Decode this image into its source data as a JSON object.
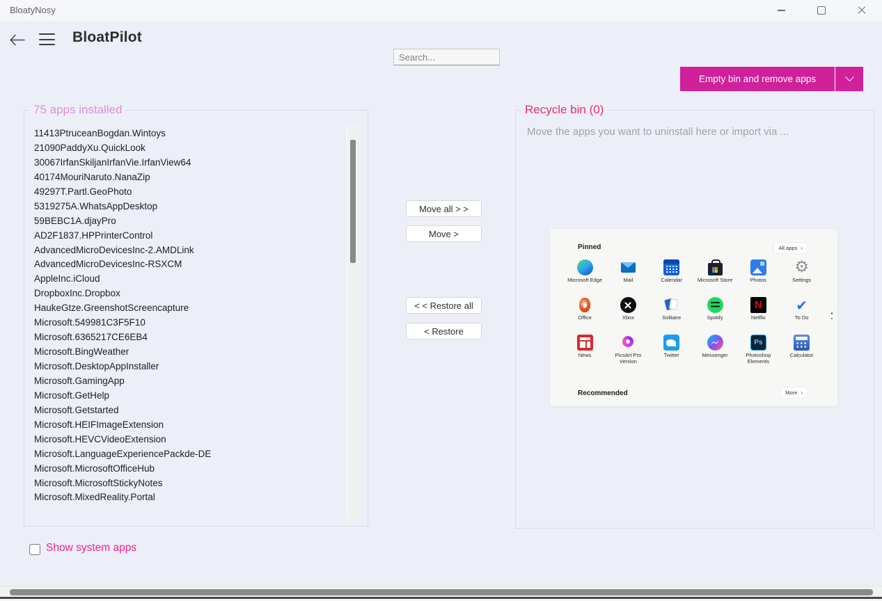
{
  "window": {
    "title": "BloatyNosy"
  },
  "header": {
    "title": "BloatPilot"
  },
  "search": {
    "placeholder": "Search..."
  },
  "primary_action": {
    "label": "Empty bin and remove apps"
  },
  "installed_panel": {
    "legend": "75 apps installed",
    "apps": [
      "11413PtruceanBogdan.Wintoys",
      "21090PaddyXu.QuickLook",
      "30067IrfanSkiljanIrfanVie.IrfanView64",
      "40174MouriNaruto.NanaZip",
      "49297T.Partl.GeoPhoto",
      "5319275A.WhatsAppDesktop",
      "59BEBC1A.djayPro",
      "AD2F1837.HPPrinterControl",
      "AdvancedMicroDevicesInc-2.AMDLink",
      "AdvancedMicroDevicesInc-RSXCM",
      "AppleInc.iCloud",
      "DropboxInc.Dropbox",
      "HaukeGtze.GreenshotScreencapture",
      "Microsoft.549981C3F5F10",
      "Microsoft.6365217CE6EB4",
      "Microsoft.BingWeather",
      "Microsoft.DesktopAppInstaller",
      "Microsoft.GamingApp",
      "Microsoft.GetHelp",
      "Microsoft.Getstarted",
      "Microsoft.HEIFImageExtension",
      "Microsoft.HEVCVideoExtension",
      "Microsoft.LanguageExperiencePackde-DE",
      "Microsoft.MicrosoftOfficeHub",
      "Microsoft.MicrosoftStickyNotes",
      "Microsoft.MixedReality.Portal"
    ]
  },
  "transfer_buttons": {
    "move_all": "Move all > >",
    "move": "Move >",
    "restore_all": "< < Restore all",
    "restore": "< Restore"
  },
  "recycle_panel": {
    "legend": "Recycle bin (0)",
    "drop_hint": "Move the apps you want to uninstall here or import via ..."
  },
  "start_menu_preview": {
    "pinned_label": "Pinned",
    "all_apps_label": "All apps",
    "recommended_label": "Recommended",
    "more_label": "More",
    "apps": [
      {
        "name": "Microsoft Edge",
        "icon": "edge"
      },
      {
        "name": "Mail",
        "icon": "mail"
      },
      {
        "name": "Calendar",
        "icon": "calendar"
      },
      {
        "name": "Microsoft Store",
        "icon": "store"
      },
      {
        "name": "Photos",
        "icon": "photos"
      },
      {
        "name": "Settings",
        "icon": "settings"
      },
      {
        "name": "Office",
        "icon": "office"
      },
      {
        "name": "Xbox",
        "icon": "xbox"
      },
      {
        "name": "Solitaire",
        "icon": "solitaire"
      },
      {
        "name": "Spotify",
        "icon": "spotify"
      },
      {
        "name": "Netflix",
        "icon": "netflix"
      },
      {
        "name": "To Do",
        "icon": "todo"
      },
      {
        "name": "News",
        "icon": "news"
      },
      {
        "name": "PicsArt Pro Version",
        "icon": "picsart"
      },
      {
        "name": "Twitter",
        "icon": "twitter"
      },
      {
        "name": "Messenger",
        "icon": "messenger"
      },
      {
        "name": "Photoshop Elements",
        "icon": "photoshop"
      },
      {
        "name": "Calculator",
        "icon": "calculator"
      }
    ]
  },
  "footer": {
    "show_system_apps_label": "Show system apps"
  },
  "colors": {
    "accent_magenta": "#d0219b",
    "installed_legend_pink": "#dd8fd8",
    "recycle_legend_pink": "#e82f6e",
    "checkbox_label_pink": "#ee2093"
  }
}
